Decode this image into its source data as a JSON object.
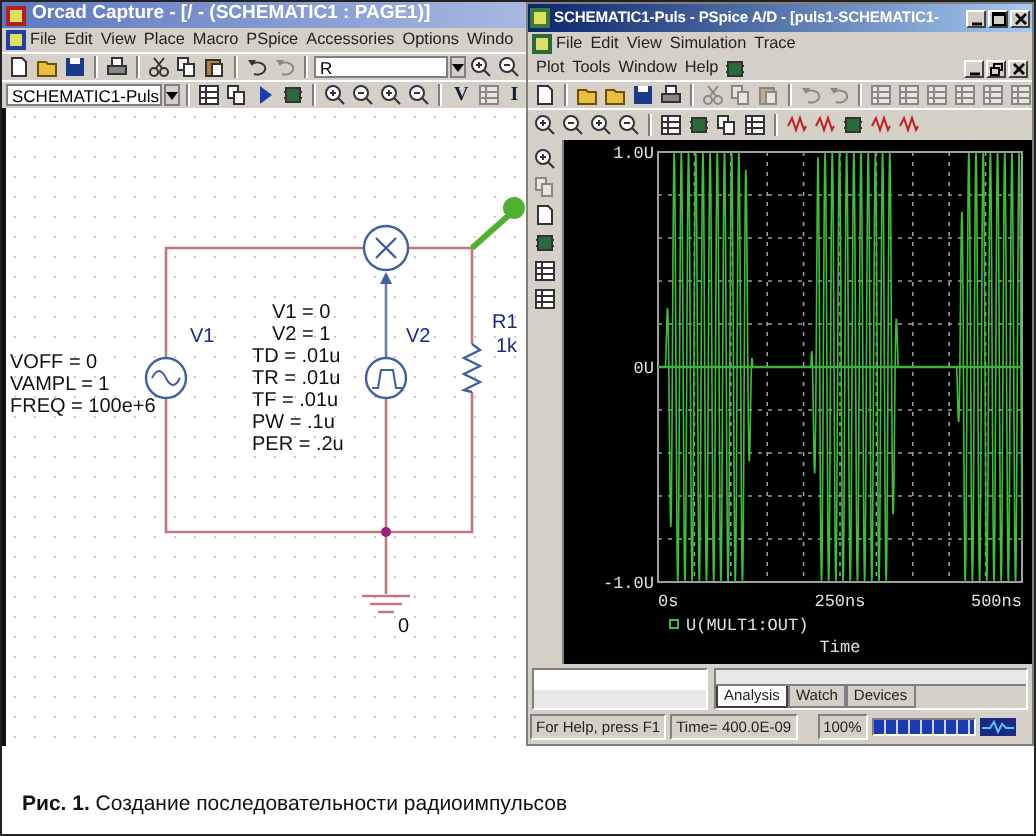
{
  "capture": {
    "title": "Orcad Capture - [/ - (SCHEMATIC1 : PAGE1)]",
    "menu": [
      "File",
      "Edit",
      "View",
      "Place",
      "Macro",
      "PSpice",
      "Accessories",
      "Options",
      "Windo"
    ],
    "part_search": "R",
    "schematic_select": "SCHEMATIC1-Puls",
    "source_buttons": [
      "V",
      "I"
    ],
    "schematic": {
      "v1": {
        "name": "V1",
        "params": [
          "VOFF = 0",
          "VAMPL = 1",
          "FREQ = 100e+6"
        ]
      },
      "v2": {
        "name": "V2",
        "params": [
          "V1 = 0",
          "V2 = 1",
          "TD = .01u",
          "TR = .01u",
          "TF = .01u",
          "PW = .1u",
          "PER = .2u"
        ]
      },
      "r1": {
        "name": "R1",
        "value": "1k"
      },
      "ground": {
        "label": "0"
      }
    }
  },
  "pspice": {
    "title": "SCHEMATIC1-Puls - PSpice A/D - [puls1-SCHEMATIC1-",
    "menu_rows": [
      [
        "File",
        "Edit",
        "View",
        "Simulation",
        "Trace"
      ],
      [
        "Plot",
        "Tools",
        "Window",
        "Help"
      ]
    ],
    "plot": {
      "y_ticks": [
        "1.0U",
        "0U",
        "-1.0U"
      ],
      "x_ticks": [
        "0s",
        "250ns",
        "500ns"
      ],
      "trace": "U(MULT1:OUT)",
      "x_label": "Time"
    },
    "tabs": [
      {
        "label": "Analysis",
        "selected": true
      },
      {
        "label": "Watch",
        "selected": false
      },
      {
        "label": "Devices",
        "selected": false
      }
    ],
    "status": {
      "help": "For Help, press F1",
      "time": "Time= 400.0E-09",
      "zoom": "100%",
      "progress": {
        "level": 1
      }
    }
  },
  "caption": "**Рис. 1.** Создание последовательности радиоимпульсов"
}
